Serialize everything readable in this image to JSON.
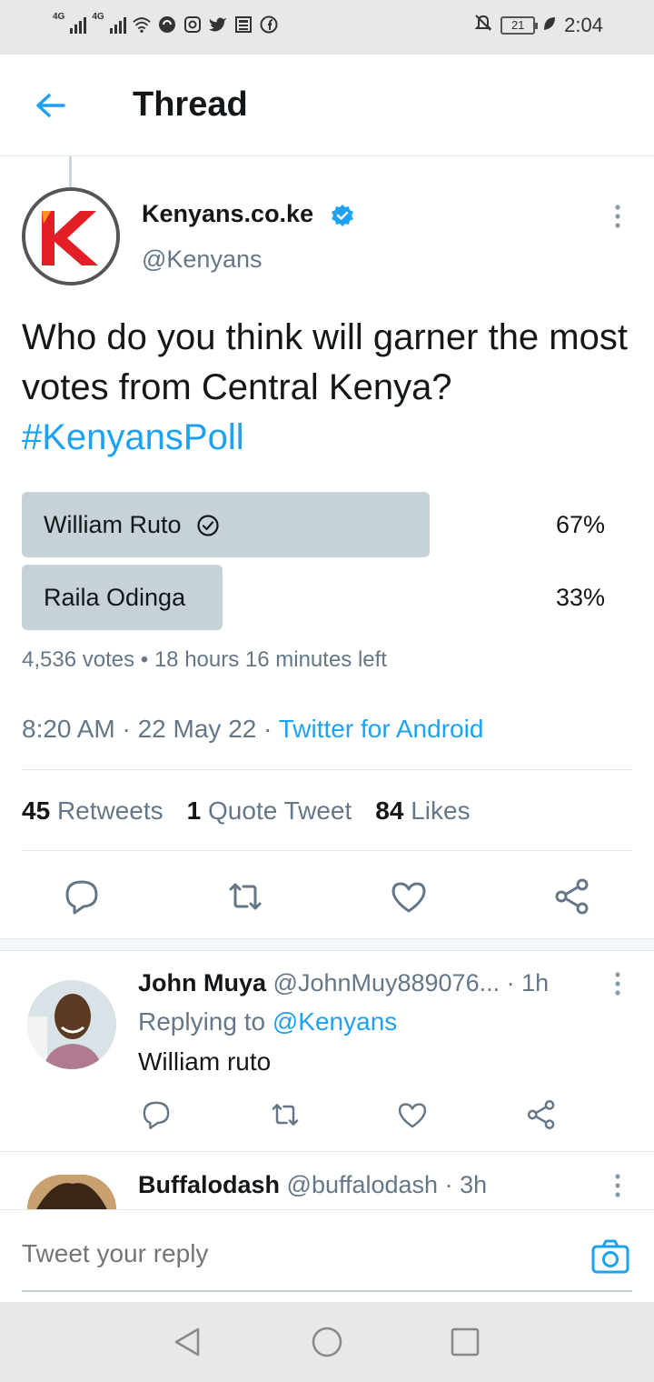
{
  "status_bar": {
    "net1": "4G",
    "net2": "4G",
    "battery": "21",
    "time": "2:04"
  },
  "header": {
    "title": "Thread"
  },
  "tweet": {
    "author_name": "Kenyans.co.ke",
    "author_handle": "@Kenyans",
    "text": "Who do you think will garner the most votes from Central Kenya?",
    "hashtag": "#KenyansPoll",
    "poll": {
      "options": [
        {
          "label": "William Ruto",
          "percent_text": "67%",
          "percent": 67,
          "winner": true
        },
        {
          "label": "Raila Odinga",
          "percent_text": "33%",
          "percent": 33,
          "winner": false
        }
      ],
      "meta": "4,536 votes • 18 hours 16 minutes left"
    },
    "time": "8:20 AM · 22 May 22 · ",
    "source": "Twitter for Android",
    "stats": {
      "retweets_count": "45",
      "retweets_label": "Retweets",
      "quotes_count": "1",
      "quotes_label": "Quote Tweet",
      "likes_count": "84",
      "likes_label": "Likes"
    }
  },
  "replies": [
    {
      "name": "John Muya",
      "handle": "@JohnMuy889076...",
      "time": "· 1h",
      "replying_prefix": "Replying to ",
      "replying_to": "@Kenyans",
      "text": "William ruto"
    },
    {
      "name": "Buffalodash",
      "handle": "@buffalodash",
      "time": "· 3h"
    }
  ],
  "reply_box": {
    "placeholder": "Tweet your reply"
  },
  "colors": {
    "accent": "#1da1f2",
    "poll_bar": "#c7d1d8",
    "secondary_text": "#657786"
  }
}
